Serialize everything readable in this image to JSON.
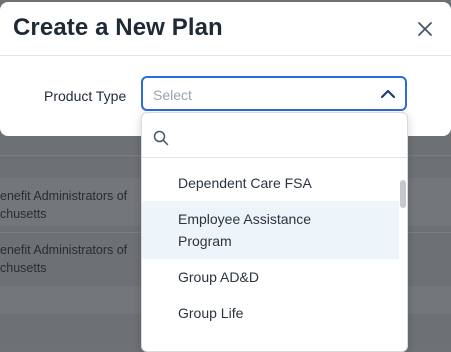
{
  "modal": {
    "title": "Create a New Plan",
    "close_label": "×"
  },
  "form": {
    "product_type_label": "Product Type",
    "select_placeholder": "Select"
  },
  "dropdown": {
    "search_placeholder": "",
    "options": [
      {
        "label": "Dependent Care FSA"
      },
      {
        "label": "Employee Assistance Program"
      },
      {
        "label": "Group AD&D"
      },
      {
        "label": "Group Life"
      }
    ]
  },
  "background": {
    "rows": [
      {
        "line1": "enefit Administrators of",
        "line2": "chusetts"
      },
      {
        "line1": "enefit Administrators of",
        "line2": "chusetts"
      }
    ]
  },
  "colors": {
    "accent": "#2f6bd8",
    "title": "#1f2a37",
    "hover_option": "#eef5fa"
  }
}
